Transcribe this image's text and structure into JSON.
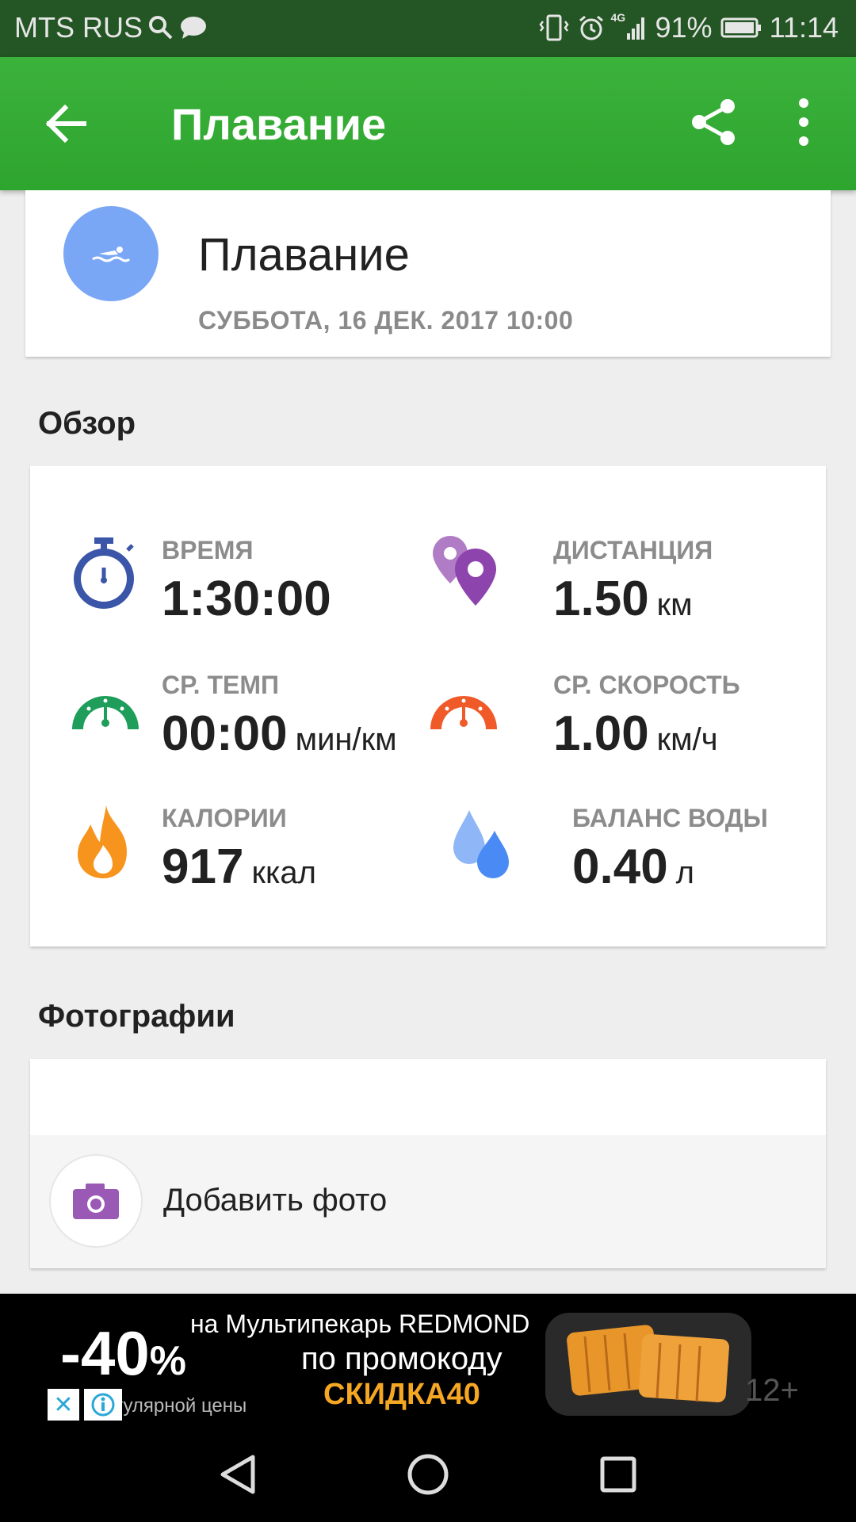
{
  "status_bar": {
    "carrier": "MTS RUS",
    "network": "4G",
    "battery": "91%",
    "time": "11:14"
  },
  "app_bar": {
    "title": "Плавание"
  },
  "activity": {
    "title": "Плавание",
    "datetime": "СУББОТА, 16 ДЕК. 2017 10:00"
  },
  "overview": {
    "section_title": "Обзор",
    "stats": [
      {
        "label": "ВРЕМЯ",
        "value": "1:30:00",
        "unit": "",
        "icon": "stopwatch-icon",
        "color": "#3b55a8"
      },
      {
        "label": "ДИСТАНЦИЯ",
        "value": "1.50",
        "unit": "км",
        "icon": "map-pins-icon",
        "color": "#8e44ad"
      },
      {
        "label": "СР. ТЕМП",
        "value": "00:00",
        "unit": "мин/км",
        "icon": "pace-gauge-icon",
        "color": "#1e9e5a"
      },
      {
        "label": "СР. СКОРОСТЬ",
        "value": "1.00",
        "unit": "км/ч",
        "icon": "speed-gauge-icon",
        "color": "#f05a28"
      },
      {
        "label": "КАЛОРИИ",
        "value": "917",
        "unit": "ккал",
        "icon": "flame-icon",
        "color": "#f7941d"
      },
      {
        "label": "БАЛАНС ВОДЫ",
        "value": "0.40",
        "unit": "л",
        "icon": "water-drops-icon",
        "color": "#4a8af4"
      }
    ]
  },
  "photos": {
    "section_title": "Фотографии",
    "add_label": "Добавить фото"
  },
  "ad": {
    "discount": "-40",
    "percent": "%",
    "line1": "на Мультипекарь REDMOND",
    "line2": "по промокоду",
    "line3": "регулярной цены",
    "promo_code": "СКИДКА40",
    "age": "12+"
  },
  "colors": {
    "status_bar": "#245524",
    "app_bar": "#34ab34",
    "swim_avatar": "#7aa7f5",
    "camera": "#9b59b6"
  }
}
